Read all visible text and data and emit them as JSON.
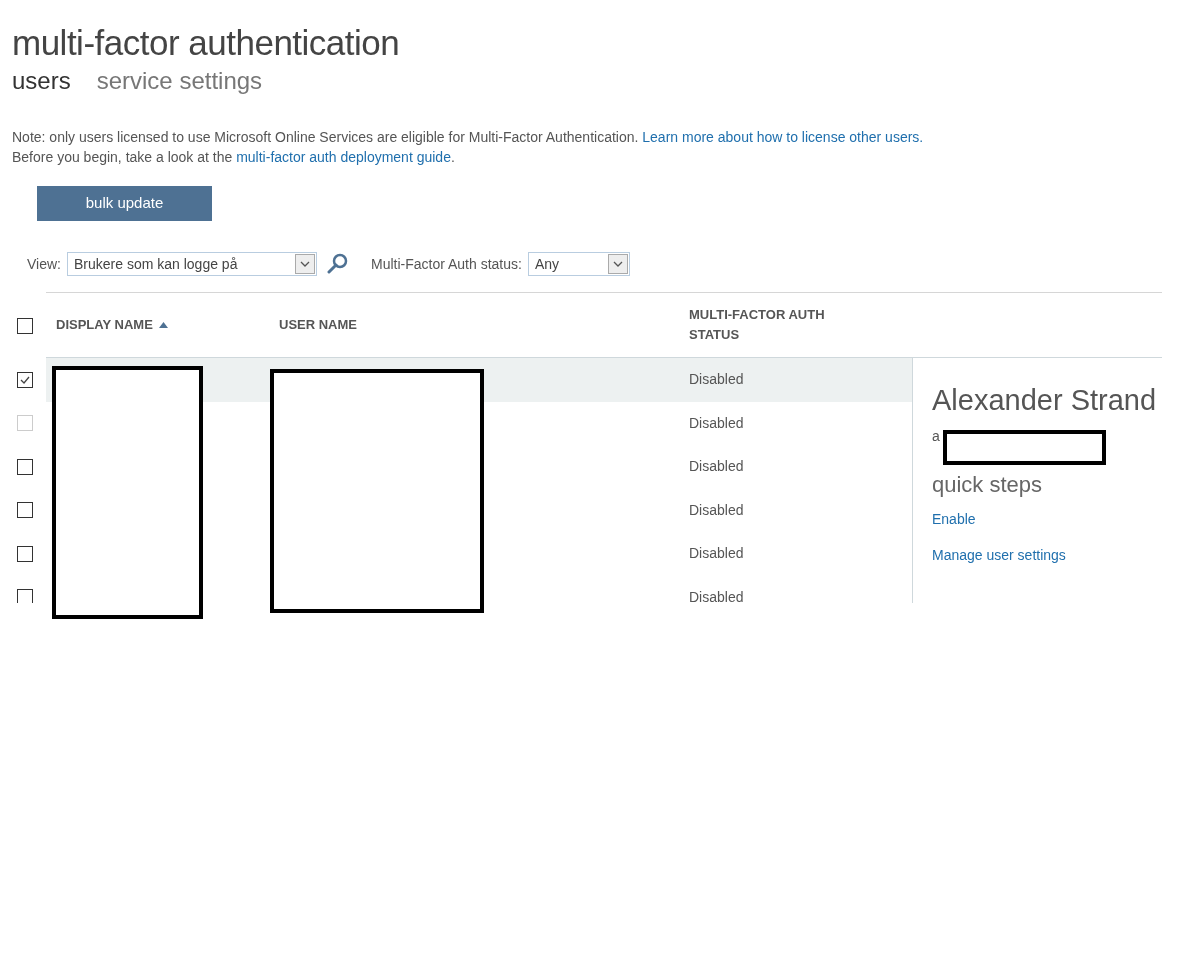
{
  "title": "multi-factor authentication",
  "tabs": [
    {
      "label": "users",
      "selected": true
    },
    {
      "label": "service settings",
      "selected": false
    }
  ],
  "note": {
    "line_1": "Note: only users licensed to use Microsoft Online Services are eligible for Multi-Factor Authentication.",
    "line_1_link": "Learn more about how to license other users.",
    "line_2": "Before you begin, take a look at the",
    "line_2_link": "multi-factor auth deployment guide",
    "line_2_end": "."
  },
  "bulk_update_button": "bulk update",
  "filters": {
    "view_label": "View:",
    "view_value": "Brukere som kan logge på",
    "status_label": "Multi-Factor Auth status:",
    "status_value": "Any"
  },
  "table": {
    "select_all_checked": false,
    "columns": [
      {
        "label": "DISPLAY NAME",
        "sorted": true
      },
      {
        "label": "USER NAME",
        "sorted": false
      },
      {
        "label": "MULTI-FACTOR AUTH STATUS",
        "sorted": false
      }
    ],
    "rows": [
      {
        "checked": true,
        "disabled": false,
        "selected": true,
        "status": "Disabled"
      },
      {
        "checked": false,
        "disabled": true,
        "selected": false,
        "status": "Disabled"
      },
      {
        "checked": false,
        "disabled": false,
        "selected": false,
        "status": "Disabled"
      },
      {
        "checked": false,
        "disabled": false,
        "selected": false,
        "status": "Disabled"
      },
      {
        "checked": false,
        "disabled": false,
        "selected": false,
        "status": "Disabled"
      },
      {
        "checked": false,
        "disabled": false,
        "selected": false,
        "status": "Disabled"
      }
    ]
  },
  "detail": {
    "name": "Alexander Strand",
    "email": "a",
    "quick_steps_title": "quick steps",
    "links": [
      "Enable",
      "Manage user settings"
    ]
  }
}
